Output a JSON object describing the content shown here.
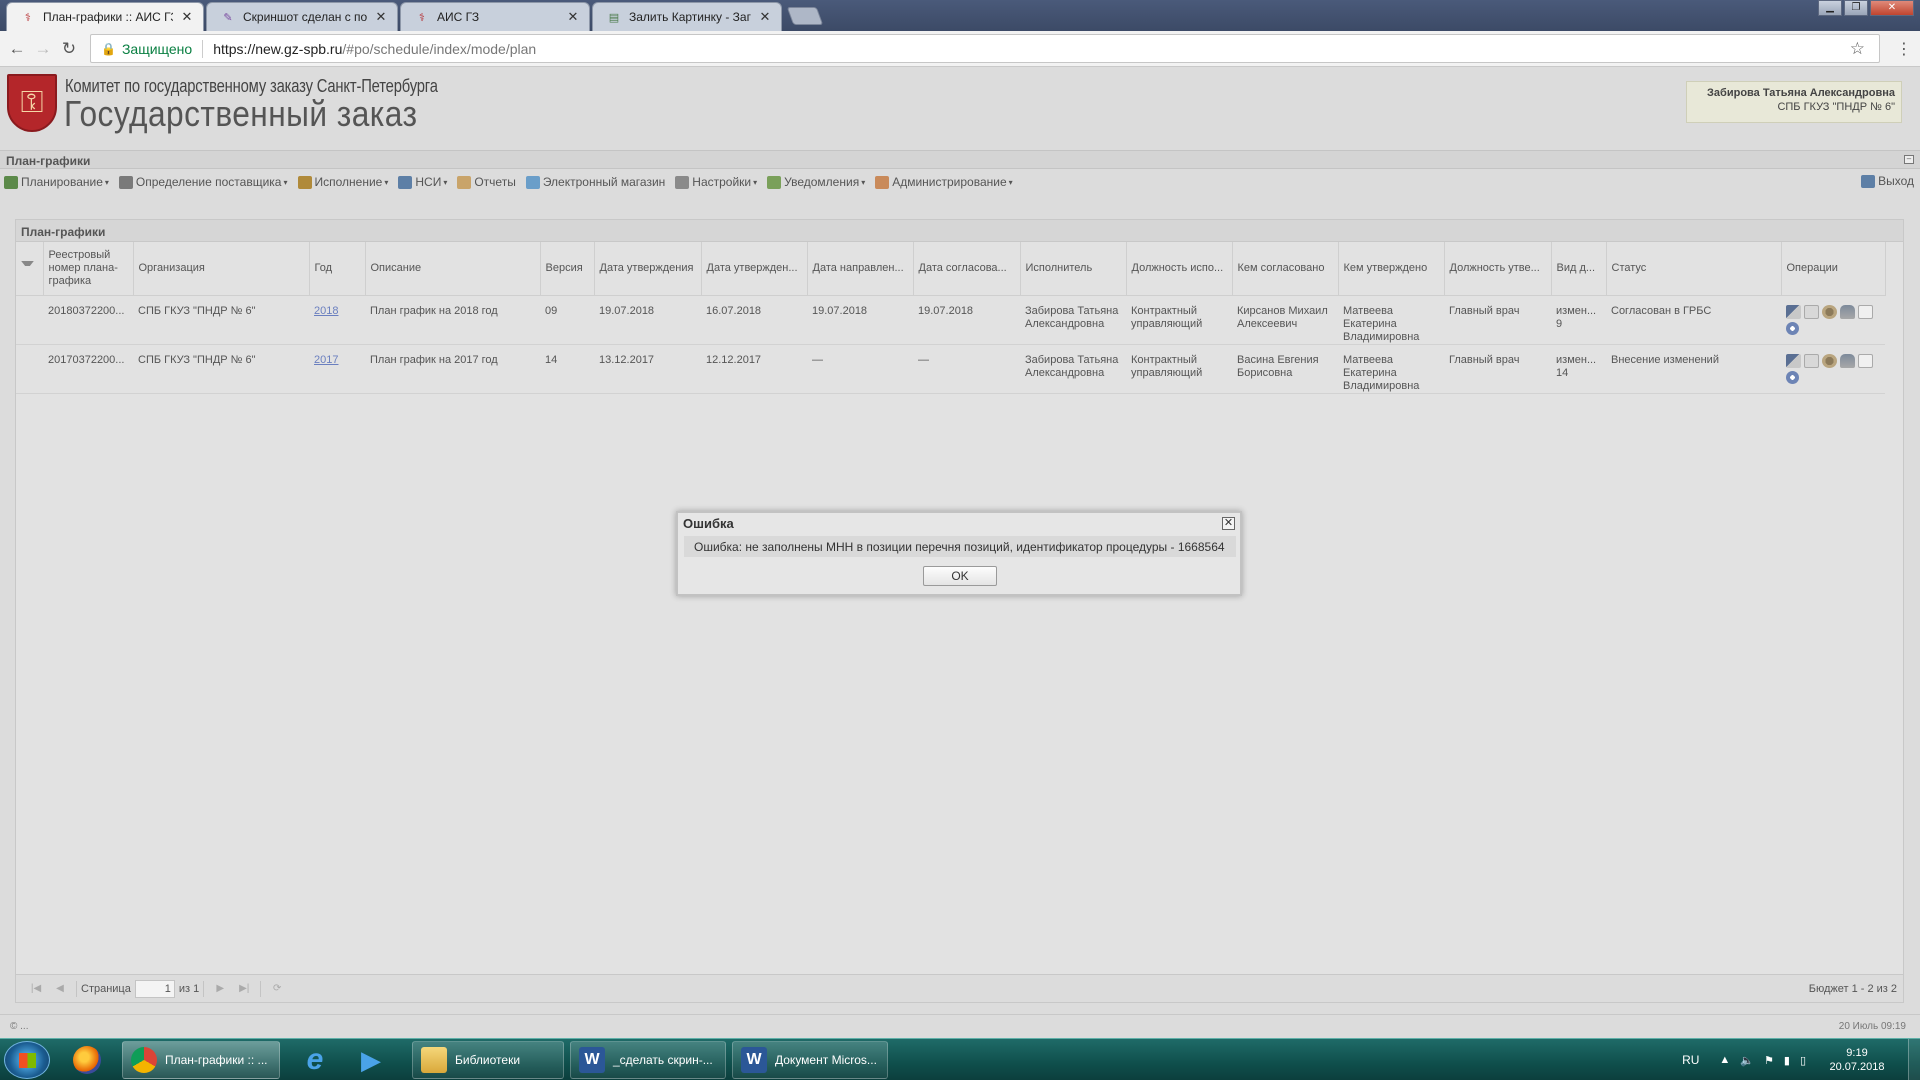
{
  "browser": {
    "tabs": [
      {
        "label": "План-графики :: АИС ГЗ",
        "active": true
      },
      {
        "label": "Скриншот сделан с пом",
        "active": false
      },
      {
        "label": "АИС ГЗ",
        "active": false
      },
      {
        "label": "Залить Картинку - Загру",
        "active": false
      }
    ],
    "secure_label": "Защищено",
    "url_host": "https://new.gz-spb.ru",
    "url_path": "/#po/schedule/index/mode/plan"
  },
  "header": {
    "org_subtitle": "Комитет по государственному заказу Санкт-Петербурга",
    "org_title": "Государственный заказ",
    "user_name": "Забирова Татьяна Александровна",
    "user_org": "СПБ ГКУЗ \"ПНДР № 6\""
  },
  "panel": {
    "title": "План-графики"
  },
  "toolbar": {
    "items": [
      {
        "label": "Планирование",
        "dropdown": true,
        "icon": "planning-icon",
        "color": "#5c8a4a"
      },
      {
        "label": "Определение поставщика",
        "dropdown": true,
        "icon": "supplier-icon",
        "color": "#7a7a7a"
      },
      {
        "label": "Исполнение",
        "dropdown": true,
        "icon": "execution-icon",
        "color": "#b08a3a"
      },
      {
        "label": "НСИ",
        "dropdown": true,
        "icon": "reference-icon",
        "color": "#5d7fa6"
      },
      {
        "label": "Отчеты",
        "dropdown": false,
        "icon": "reports-icon",
        "color": "#c9a46a"
      },
      {
        "label": "Электронный магазин",
        "dropdown": false,
        "icon": "eshop-icon",
        "color": "#6a9ec9"
      },
      {
        "label": "Настройки",
        "dropdown": true,
        "icon": "settings-icon",
        "color": "#8a8a8a"
      },
      {
        "label": "Уведомления",
        "dropdown": true,
        "icon": "notifications-icon",
        "color": "#7aa05a"
      },
      {
        "label": "Администрирование",
        "dropdown": true,
        "icon": "admin-icon",
        "color": "#c98a5a"
      }
    ],
    "exit_label": "Выход"
  },
  "grid": {
    "title": "План-графики",
    "columns": [
      "Реестровый номер плана-графика",
      "Организация",
      "Год",
      "Описание",
      "Версия",
      "Дата утверждения",
      "Дата утвержден...",
      "Дата направлен...",
      "Дата согласова...",
      "Исполнитель",
      "Должность испо...",
      "Кем согласовано",
      "Кем утверждено",
      "Должность утве...",
      "Вид д...",
      "Статус",
      "Операции"
    ],
    "rows": [
      {
        "reg": "20180372200...",
        "org": "СПБ ГКУЗ \"ПНДР № 6\"",
        "year": "2018",
        "desc": "План график на 2018 год",
        "version": "09",
        "d1": "19.07.2018",
        "d2": "16.07.2018",
        "d3": "19.07.2018",
        "d4": "19.07.2018",
        "executor": "Забирова Татьяна Александровна",
        "exec_pos": "Контрактный управляющий",
        "agreed_by": "Кирсанов Михаил Алексеевич",
        "approved_by": "Матвеева Екатерина Владимировна",
        "appr_pos": "Главный врач",
        "kind": "измен... 9",
        "status": "Согласован в ГРБС"
      },
      {
        "reg": "20170372200...",
        "org": "СПБ ГКУЗ \"ПНДР № 6\"",
        "year": "2017",
        "desc": "План график на 2017 год",
        "version": "14",
        "d1": "13.12.2017",
        "d2": "12.12.2017",
        "d3": "—",
        "d4": "—",
        "executor": "Забирова Татьяна Александровна",
        "exec_pos": "Контрактный управляющий",
        "agreed_by": "Васина Евгения Борисовна",
        "approved_by": "Матвеева Екатерина Владимировна",
        "appr_pos": "Главный врач",
        "kind": "измен... 14",
        "status": "Внесение изменений"
      }
    ]
  },
  "pager": {
    "page_label": "Страница",
    "page_value": "1",
    "of_label": "из 1",
    "summary": "Бюджет 1 - 2 из 2"
  },
  "statusbar": {
    "left": "© ...",
    "right": "20 Июль 09:19"
  },
  "dialog": {
    "title": "Ошибка",
    "message": "Ошибка: не заполнены МНН в позиции перечня позиций, идентификатор процедуры - 1668564",
    "ok_label": "OK"
  },
  "taskbar": {
    "tasks": [
      {
        "label": "План-графики :: ...",
        "active": true
      },
      {
        "label": "Библиотеки",
        "active": false
      },
      {
        "label": "_сделать скрин-...",
        "active": false
      },
      {
        "label": "Документ Micros...",
        "active": false
      }
    ],
    "lang": "RU",
    "time": "9:19",
    "date": "20.07.2018"
  }
}
